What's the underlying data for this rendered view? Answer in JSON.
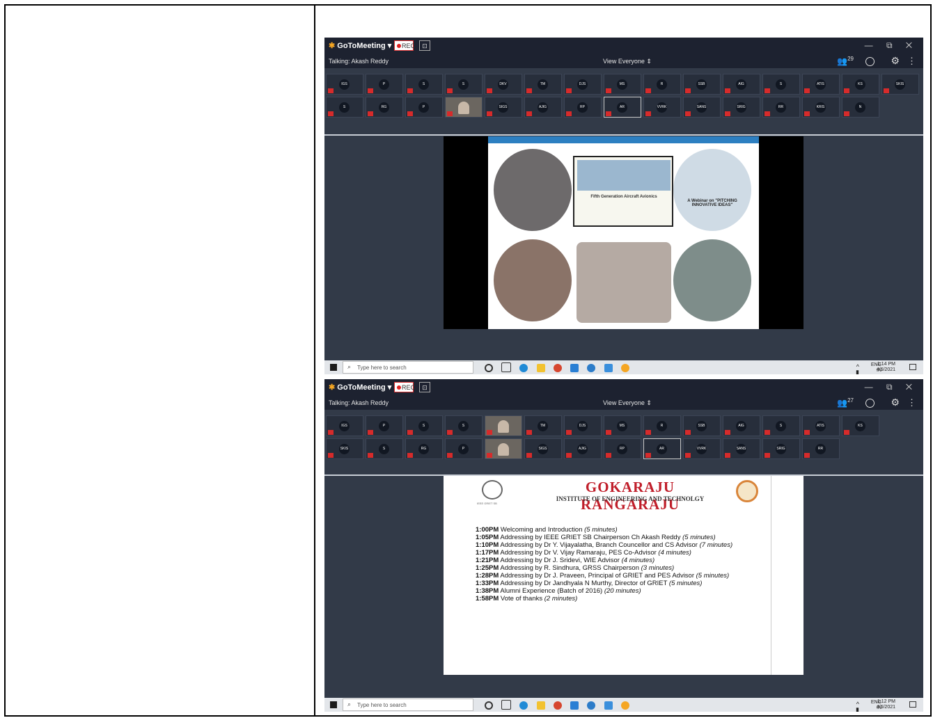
{
  "window1": {
    "app_name_prefix": "GoTo",
    "app_name_suffix": "Meeting ▾",
    "rec_label": "REC",
    "window_controls": "— ⧉ ✕",
    "talking": "Talking: Akash Reddy",
    "view_selector": "View Everyone ⇕",
    "attendee_count": "29",
    "tiles_row1": [
      "IGS",
      "P",
      "S",
      "S",
      "DKV",
      "TM",
      "DJS",
      "MS",
      "R",
      "SSB",
      "AIG",
      "S",
      "ATIS",
      "KS",
      "SKIS"
    ],
    "tiles_row2": [
      "S",
      "RG",
      "P",
      "",
      "SIGS",
      "AJIG",
      "RP",
      "AR",
      "VVRK",
      "SANS",
      "SRIG",
      "RR",
      "KRIS",
      "N"
    ],
    "poster_title": "Fifth Generation Aircraft Avionics",
    "webinar_text": "A Webinar on \"PITCHING INNOVATIVE IDEAS\"",
    "taskbar": {
      "search_placeholder": "Type here to search",
      "lang": "ENG",
      "region": "IN",
      "time": "1:14 PM",
      "date": "4/6/2021"
    }
  },
  "window2": {
    "app_name_prefix": "GoTo",
    "app_name_suffix": "Meeting ▾",
    "rec_label": "REC",
    "window_controls": "— ⧉ ✕",
    "talking": "Talking: Akash Reddy",
    "view_selector": "View Everyone ⇕",
    "attendee_count": "27",
    "tiles_row1": [
      "IGS",
      "P",
      "S",
      "S",
      "",
      "TM",
      "DJS",
      "MS",
      "R",
      "SSB",
      "AIG",
      "S",
      "ATIS",
      "KS"
    ],
    "tiles_row2": [
      "SKIS",
      "S",
      "RG",
      "P",
      "",
      "SIGS",
      "AJIG",
      "RP",
      "AR",
      "VVRK",
      "SANS",
      "SRIG",
      "RR"
    ],
    "slide": {
      "title": "GOKARAJU RANGARAJU",
      "subtitle": "INSTITUTE OF ENGINEERING AND TECHNOLGY",
      "left_logo_caption": "IEEE GRIET SB",
      "agenda": [
        {
          "time": "1:00PM",
          "text": " Welcoming and Introduction ",
          "dur": "(5 minutes)"
        },
        {
          "time": "1:05PM",
          "text": " Addressing by IEEE GRIET SB Chairperson Ch Akash Reddy ",
          "dur": "(5 minutes)"
        },
        {
          "time": "1:10PM",
          "text": " Addressing by Dr Y. Vijayalatha, Branch Councellor and CS Advisor ",
          "dur": "(7 minutes)"
        },
        {
          "time": "1:17PM",
          "text": " Addressing by Dr V. Vijay Ramaraju, PES Co-Advisor ",
          "dur": "(4 minutes)"
        },
        {
          "time": "1:21PM",
          "text": " Addressing by Dr J. Sridevi, WIE Advisor ",
          "dur": "(4 minutes)"
        },
        {
          "time": "1:25PM",
          "text": " Addressing by R. Sindhura, GRSS Chairperson ",
          "dur": "(3 minutes)"
        },
        {
          "time": "1:28PM",
          "text": " Addressing by Dr J. Praveen, Principal of GRIET and PES Advisor ",
          "dur": "(5 minutes)"
        },
        {
          "time": "1:33PM",
          "text": " Addressing by Dr Jandhyala N Murthy, Director of GRIET ",
          "dur": "(5 minutes)"
        },
        {
          "time": "1:38PM",
          "text": " Alumni Experience (Batch of 2016) ",
          "dur": "(20 minutes)"
        },
        {
          "time": "1:58PM",
          "text": " Vote of thanks ",
          "dur": "(2 minutes)"
        }
      ]
    },
    "taskbar": {
      "search_placeholder": "Type here to search",
      "lang": "ENG",
      "region": "IN",
      "time": "1:12 PM",
      "date": "4/6/2021"
    }
  },
  "colors": {
    "meeting_bg": "#323a48",
    "titlebar": "#1d2230",
    "brand_red": "#c01e2a",
    "mute_red": "#d62b2b"
  }
}
